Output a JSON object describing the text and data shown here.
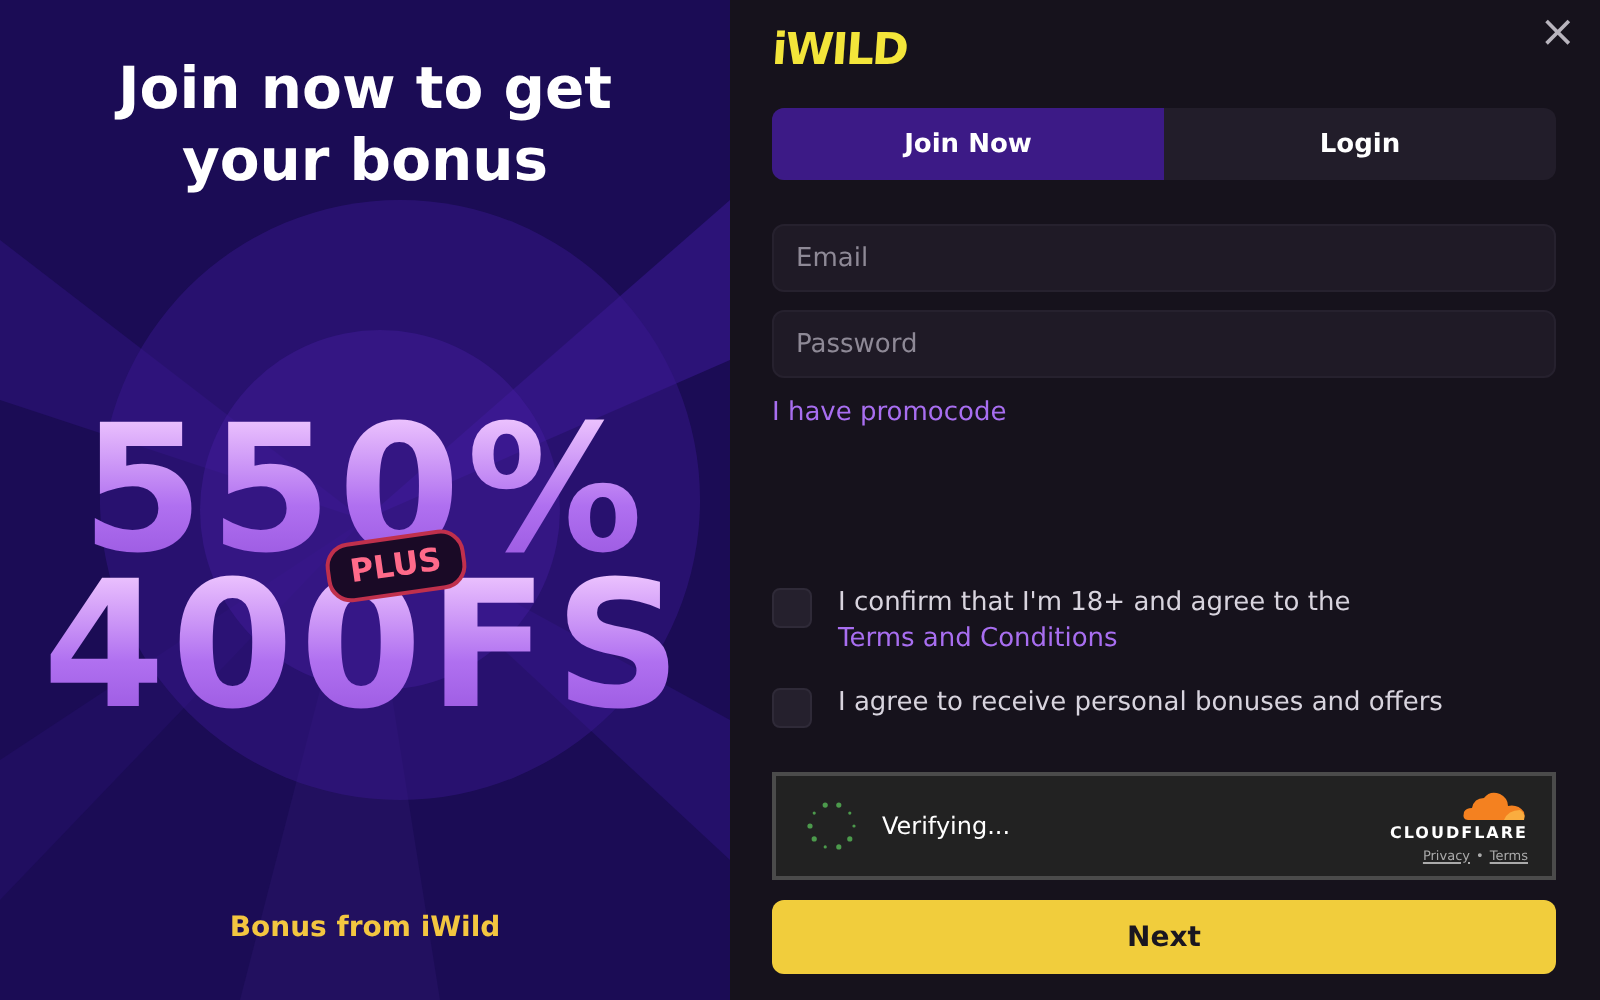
{
  "promo": {
    "headline": "Join now to get your bonus",
    "bonus_amount": "550%",
    "plus_badge": "PLUS",
    "free_spins": "400FS",
    "footer": "Bonus from iWild"
  },
  "logo": "iWILD",
  "close": "×",
  "tabs": [
    {
      "label": "Join Now",
      "selected": true
    },
    {
      "label": "Login",
      "selected": false
    }
  ],
  "fields": [
    {
      "placeholder": "Email"
    },
    {
      "placeholder": "Password"
    }
  ],
  "promocode_link": "I have promocode",
  "checkboxes": [
    {
      "text": "I confirm that I'm 18+ and agree to the ",
      "link": "Terms and Conditions",
      "checked": false
    },
    {
      "text": "I agree to receive personal bonuses and offers",
      "checked": false
    }
  ],
  "captcha": {
    "status": "Verifying...",
    "brand": "CLOUDFLARE",
    "links": [
      "Privacy",
      "Terms"
    ],
    "separator": "•"
  },
  "submit": "Next"
}
